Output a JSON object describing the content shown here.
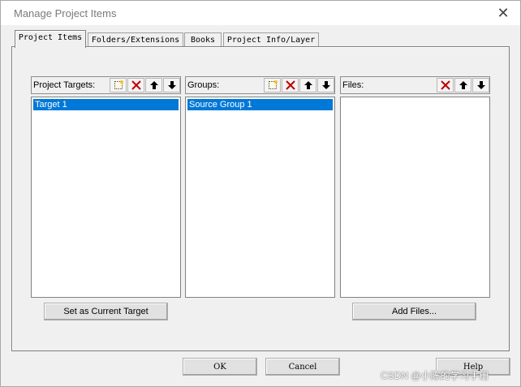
{
  "window": {
    "title": "Manage Project Items",
    "close_symbol": "✕"
  },
  "tabs": [
    {
      "label": "Project Items",
      "active": true
    },
    {
      "label": "Folders/Extensions",
      "active": false
    },
    {
      "label": "Books",
      "active": false
    },
    {
      "label": "Project Info/Layer",
      "active": false
    }
  ],
  "panels": {
    "targets": {
      "label": "Project Targets:",
      "items": [
        "Target 1"
      ],
      "selected": 0
    },
    "groups": {
      "label": "Groups:",
      "items": [
        "Source Group 1"
      ],
      "selected": 0
    },
    "files": {
      "label": "Files:",
      "items": []
    }
  },
  "buttons": {
    "set_current_target": "Set as Current Target",
    "add_files": "Add Files...",
    "ok": "OK",
    "cancel": "Cancel",
    "help": "Help"
  },
  "watermark": "CSDN @小陈的学习手册",
  "colors": {
    "selection": "#0078d7",
    "dialog_bg": "#f0f0f0",
    "delete_icon": "#c00000"
  },
  "icons": {
    "new": "new-item-icon",
    "delete": "delete-icon",
    "up": "move-up-icon",
    "down": "move-down-icon"
  }
}
